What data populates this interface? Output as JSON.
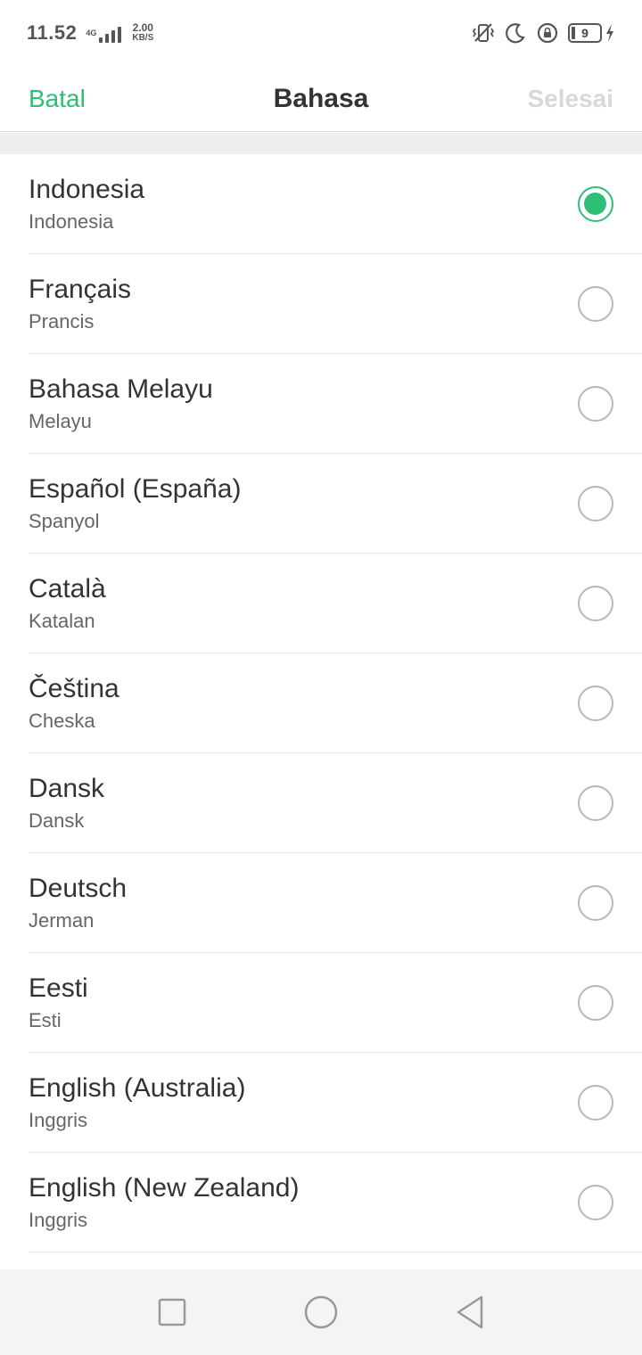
{
  "status_bar": {
    "time": "11.52",
    "network": "4G",
    "speed_value": "2.00",
    "speed_unit": "KB/S",
    "battery_level": "9",
    "icons": [
      "vibrate-icon",
      "moon-icon",
      "rotation-lock-icon",
      "battery-icon",
      "charging-icon"
    ]
  },
  "header": {
    "cancel_label": "Batal",
    "title": "Bahasa",
    "done_label": "Selesai"
  },
  "accent_color": "#2fbe75",
  "languages": [
    {
      "name": "Indonesia",
      "sub": "Indonesia",
      "selected": true
    },
    {
      "name": "Français",
      "sub": "Prancis",
      "selected": false
    },
    {
      "name": "Bahasa Melayu",
      "sub": "Melayu",
      "selected": false
    },
    {
      "name": "Español (España)",
      "sub": "Spanyol",
      "selected": false
    },
    {
      "name": "Català",
      "sub": "Katalan",
      "selected": false
    },
    {
      "name": "Čeština",
      "sub": "Cheska",
      "selected": false
    },
    {
      "name": "Dansk",
      "sub": "Dansk",
      "selected": false
    },
    {
      "name": "Deutsch",
      "sub": "Jerman",
      "selected": false
    },
    {
      "name": "Eesti",
      "sub": "Esti",
      "selected": false
    },
    {
      "name": "English (Australia)",
      "sub": "Inggris",
      "selected": false
    },
    {
      "name": "English (New Zealand)",
      "sub": "Inggris",
      "selected": false
    }
  ],
  "nav_bar": {
    "icons": [
      "recents-square-icon",
      "home-circle-icon",
      "back-triangle-icon"
    ]
  }
}
